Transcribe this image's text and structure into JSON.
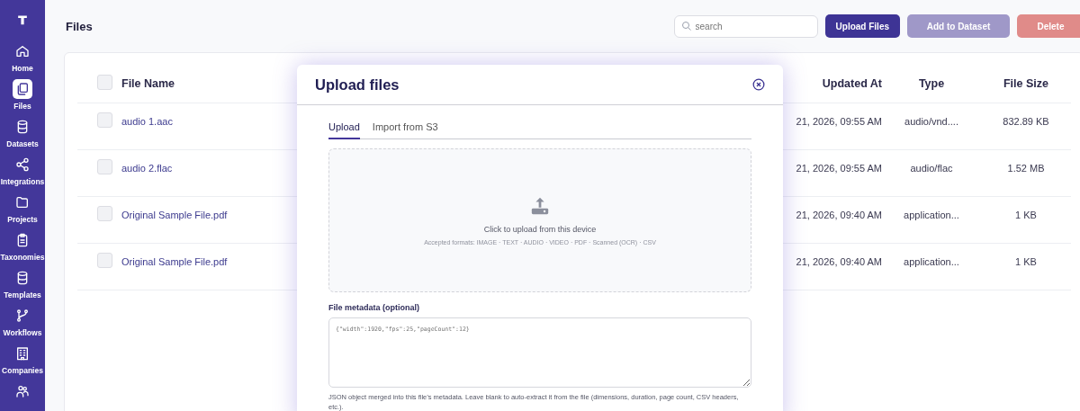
{
  "sidebar": {
    "items": [
      {
        "label": "Home",
        "selected": false
      },
      {
        "label": "Files",
        "selected": true
      },
      {
        "label": "Datasets",
        "selected": false
      },
      {
        "label": "Integrations",
        "selected": false
      },
      {
        "label": "Projects",
        "selected": false
      },
      {
        "label": "Taxonomies",
        "selected": false
      },
      {
        "label": "Templates",
        "selected": false
      },
      {
        "label": "Workflows",
        "selected": false
      },
      {
        "label": "Companies",
        "selected": false
      },
      {
        "selected": false
      }
    ]
  },
  "page": {
    "title": "Files"
  },
  "toolbar": {
    "search": {
      "placeholder": "search"
    },
    "buttons": [
      {
        "label": "Upload Files",
        "kind": "primary",
        "disabled": false
      },
      {
        "label": "Add to Dataset",
        "kind": "primary",
        "disabled": true
      },
      {
        "label": "Delete",
        "kind": "danger",
        "disabled": true
      }
    ]
  },
  "table": {
    "all_checked": false,
    "columns": [
      "File Name",
      "Updated At",
      "Type",
      "File Size"
    ],
    "rows": [
      {
        "checked": false,
        "name": "audio 1.aac",
        "updated": "21, 2026, 09:55 AM",
        "type": "audio/vnd....",
        "size": "832.89 KB"
      },
      {
        "checked": false,
        "name": "audio 2.flac",
        "updated": "21, 2026, 09:55 AM",
        "type": "audio/flac",
        "size": "1.52 MB"
      },
      {
        "checked": false,
        "name": "Original Sample File.pdf",
        "updated": "21, 2026, 09:40 AM",
        "type": "application...",
        "size": "1 KB"
      },
      {
        "checked": false,
        "name": "Original Sample File.pdf",
        "updated": "21, 2026, 09:40 AM",
        "type": "application...",
        "size": "1 KB"
      }
    ]
  },
  "dialog": {
    "title": "Upload files",
    "tabs": [
      {
        "label": "Upload",
        "selected": true
      },
      {
        "label": "Import from S3",
        "selected": false
      }
    ],
    "dropzone": {
      "prompt": "Click to upload from this device",
      "formats": "Accepted formats: IMAGE · TEXT · AUDIO · VIDEO · PDF · Scanned (OCR) · CSV"
    },
    "metadata": {
      "label": "File metadata (optional)",
      "placeholder": "{\"width\":1920,\"fps\":25,\"pageCount\":12}",
      "help": "JSON object merged into this file’s metadata. Leave blank to auto-extract it from the file (dimensions, duration, page count, CSV headers, etc.)."
    }
  }
}
